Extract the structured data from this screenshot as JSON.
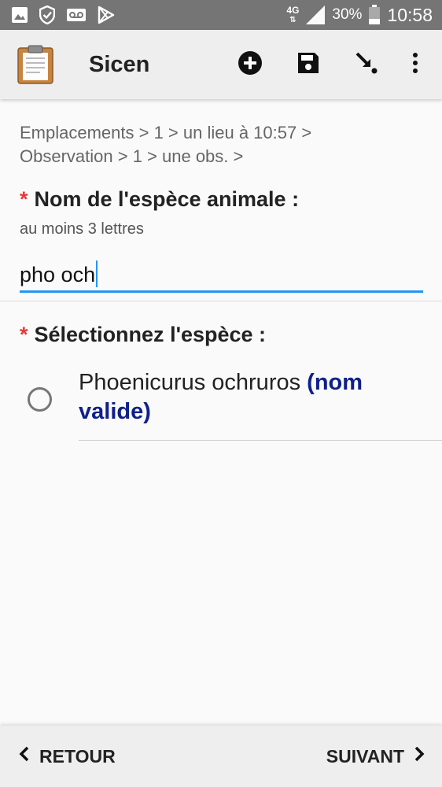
{
  "status_bar": {
    "network_label": "4G",
    "battery": "30%",
    "time": "10:58"
  },
  "app_bar": {
    "title": "Sicen",
    "actions": [
      "add-icon",
      "save-icon",
      "arrow-down-right-icon",
      "more-vert-icon"
    ]
  },
  "breadcrumb": {
    "line1": "Emplacements > 1 > un lieu à 10:57 >",
    "line2": "Observation > 1 > une obs.  >"
  },
  "question1": {
    "required_mark": "*",
    "label": "Nom de l'espèce animale :",
    "hint": "au moins 3 lettres",
    "value": "pho och"
  },
  "question2": {
    "required_mark": "*",
    "label": "Sélectionnez l'espèce :",
    "options": [
      {
        "name": "Phoenicurus ochruros",
        "tag": "(nom valide)",
        "selected": false
      }
    ]
  },
  "footer": {
    "back_label": "RETOUR",
    "next_label": "SUIVANT"
  },
  "colors": {
    "accent": "#2196f3",
    "required": "#e53935",
    "valid_tag": "#10208a",
    "status_bar": "#757575"
  }
}
